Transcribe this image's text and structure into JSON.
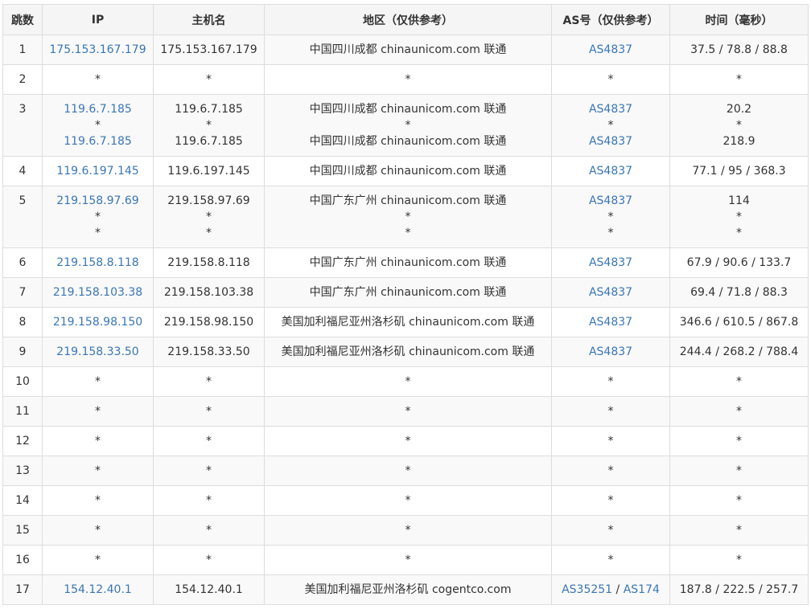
{
  "headers": {
    "hop": "跳数",
    "ip": "IP",
    "hostname": "主机名",
    "location": "地区（仅供参考）",
    "as": "AS号（仅供参考）",
    "time": "时间（毫秒）"
  },
  "rows": [
    {
      "hop": "1",
      "lines": [
        {
          "ip": "175.153.167.179",
          "host": "175.153.167.179",
          "loc": "中国四川成都 chinaunicom.com 联通",
          "as": [
            "AS4837"
          ],
          "time": "37.5 / 78.8 / 88.8"
        }
      ]
    },
    {
      "hop": "2",
      "lines": [
        {
          "ip": "*",
          "host": "*",
          "loc": "*",
          "as": [
            "*"
          ],
          "time": "*"
        }
      ]
    },
    {
      "hop": "3",
      "lines": [
        {
          "ip": "119.6.7.185",
          "host": "119.6.7.185",
          "loc": "中国四川成都 chinaunicom.com 联通",
          "as": [
            "AS4837"
          ],
          "time": "20.2"
        },
        {
          "ip": "*",
          "host": "*",
          "loc": "*",
          "as": [
            "*"
          ],
          "time": "*"
        },
        {
          "ip": "119.6.7.185",
          "host": "119.6.7.185",
          "loc": "中国四川成都 chinaunicom.com 联通",
          "as": [
            "AS4837"
          ],
          "time": "218.9"
        }
      ]
    },
    {
      "hop": "4",
      "lines": [
        {
          "ip": "119.6.197.145",
          "host": "119.6.197.145",
          "loc": "中国四川成都 chinaunicom.com 联通",
          "as": [
            "AS4837"
          ],
          "time": "77.1 / 95 / 368.3"
        }
      ]
    },
    {
      "hop": "5",
      "lines": [
        {
          "ip": "219.158.97.69",
          "host": "219.158.97.69",
          "loc": "中国广东广州 chinaunicom.com 联通",
          "as": [
            "AS4837"
          ],
          "time": "114"
        },
        {
          "ip": "*",
          "host": "*",
          "loc": "*",
          "as": [
            "*"
          ],
          "time": "*"
        },
        {
          "ip": "*",
          "host": "*",
          "loc": "*",
          "as": [
            "*"
          ],
          "time": "*"
        }
      ]
    },
    {
      "hop": "6",
      "lines": [
        {
          "ip": "219.158.8.118",
          "host": "219.158.8.118",
          "loc": "中国广东广州 chinaunicom.com 联通",
          "as": [
            "AS4837"
          ],
          "time": "67.9 / 90.6 / 133.7"
        }
      ]
    },
    {
      "hop": "7",
      "lines": [
        {
          "ip": "219.158.103.38",
          "host": "219.158.103.38",
          "loc": "中国广东广州 chinaunicom.com 联通",
          "as": [
            "AS4837"
          ],
          "time": "69.4 / 71.8 / 88.3"
        }
      ]
    },
    {
      "hop": "8",
      "lines": [
        {
          "ip": "219.158.98.150",
          "host": "219.158.98.150",
          "loc": "美国加利福尼亚州洛杉矶 chinaunicom.com 联通",
          "as": [
            "AS4837"
          ],
          "time": "346.6 / 610.5 / 867.8"
        }
      ]
    },
    {
      "hop": "9",
      "lines": [
        {
          "ip": "219.158.33.50",
          "host": "219.158.33.50",
          "loc": "美国加利福尼亚州洛杉矶 chinaunicom.com 联通",
          "as": [
            "AS4837"
          ],
          "time": "244.4 / 268.2 / 788.4"
        }
      ]
    },
    {
      "hop": "10",
      "lines": [
        {
          "ip": "*",
          "host": "*",
          "loc": "*",
          "as": [
            "*"
          ],
          "time": "*"
        }
      ]
    },
    {
      "hop": "11",
      "lines": [
        {
          "ip": "*",
          "host": "*",
          "loc": "*",
          "as": [
            "*"
          ],
          "time": "*"
        }
      ]
    },
    {
      "hop": "12",
      "lines": [
        {
          "ip": "*",
          "host": "*",
          "loc": "*",
          "as": [
            "*"
          ],
          "time": "*"
        }
      ]
    },
    {
      "hop": "13",
      "lines": [
        {
          "ip": "*",
          "host": "*",
          "loc": "*",
          "as": [
            "*"
          ],
          "time": "*"
        }
      ]
    },
    {
      "hop": "14",
      "lines": [
        {
          "ip": "*",
          "host": "*",
          "loc": "*",
          "as": [
            "*"
          ],
          "time": "*"
        }
      ]
    },
    {
      "hop": "15",
      "lines": [
        {
          "ip": "*",
          "host": "*",
          "loc": "*",
          "as": [
            "*"
          ],
          "time": "*"
        }
      ]
    },
    {
      "hop": "16",
      "lines": [
        {
          "ip": "*",
          "host": "*",
          "loc": "*",
          "as": [
            "*"
          ],
          "time": "*"
        }
      ]
    },
    {
      "hop": "17",
      "lines": [
        {
          "ip": "154.12.40.1",
          "host": "154.12.40.1",
          "loc": "美国加利福尼亚州洛杉矶 cogentco.com",
          "as": [
            "AS35251",
            "AS174"
          ],
          "time": "187.8 / 222.5 / 257.7"
        }
      ]
    }
  ],
  "colors": {
    "link": "#3a76b5",
    "text": "#333333",
    "header_bg": "#f5f5f5",
    "stripe_bg": "#f9f9f9",
    "border": "#dddddd"
  }
}
